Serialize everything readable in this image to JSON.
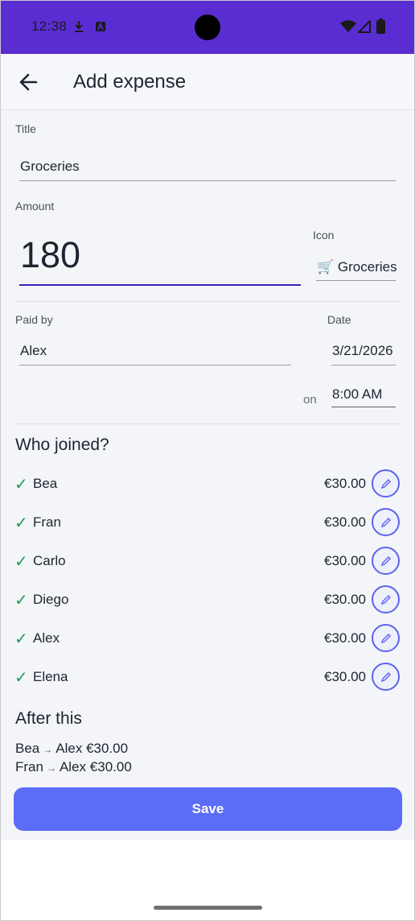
{
  "status_bar": {
    "time": "12:38"
  },
  "app_bar": {
    "title": "Add expense"
  },
  "form": {
    "title_label": "Title",
    "title_value": "Groceries",
    "amount_label": "Amount",
    "amount_value": "180",
    "icon_label": "Icon",
    "icon_glyph": "🛒",
    "icon_value": "Groceries",
    "paid_by_label": "Paid by",
    "paid_by_value": "Alex",
    "date_label": "Date",
    "date_value": "3/21/2026",
    "on_label": "on",
    "time_value": "8:00 AM"
  },
  "who_joined": {
    "title": "Who joined?",
    "check_glyph": "✓",
    "members": [
      {
        "name": "Bea",
        "amount": "€30.00"
      },
      {
        "name": "Fran",
        "amount": "€30.00"
      },
      {
        "name": "Carlo",
        "amount": "€30.00"
      },
      {
        "name": "Diego",
        "amount": "€30.00"
      },
      {
        "name": "Alex",
        "amount": "€30.00"
      },
      {
        "name": "Elena",
        "amount": "€30.00"
      }
    ]
  },
  "after_this": {
    "title": "After this",
    "arrow": "→",
    "settlements": [
      {
        "from": "Bea",
        "to": "Alex",
        "amount": "€30.00"
      },
      {
        "from": "Fran",
        "to": "Alex",
        "amount": "€30.00"
      }
    ]
  },
  "actions": {
    "save_label": "Save"
  },
  "colors": {
    "status_bar": "#5a2dd3",
    "accent": "#5b63f0",
    "save": "#5b6cf7",
    "check": "#1e9b55"
  }
}
